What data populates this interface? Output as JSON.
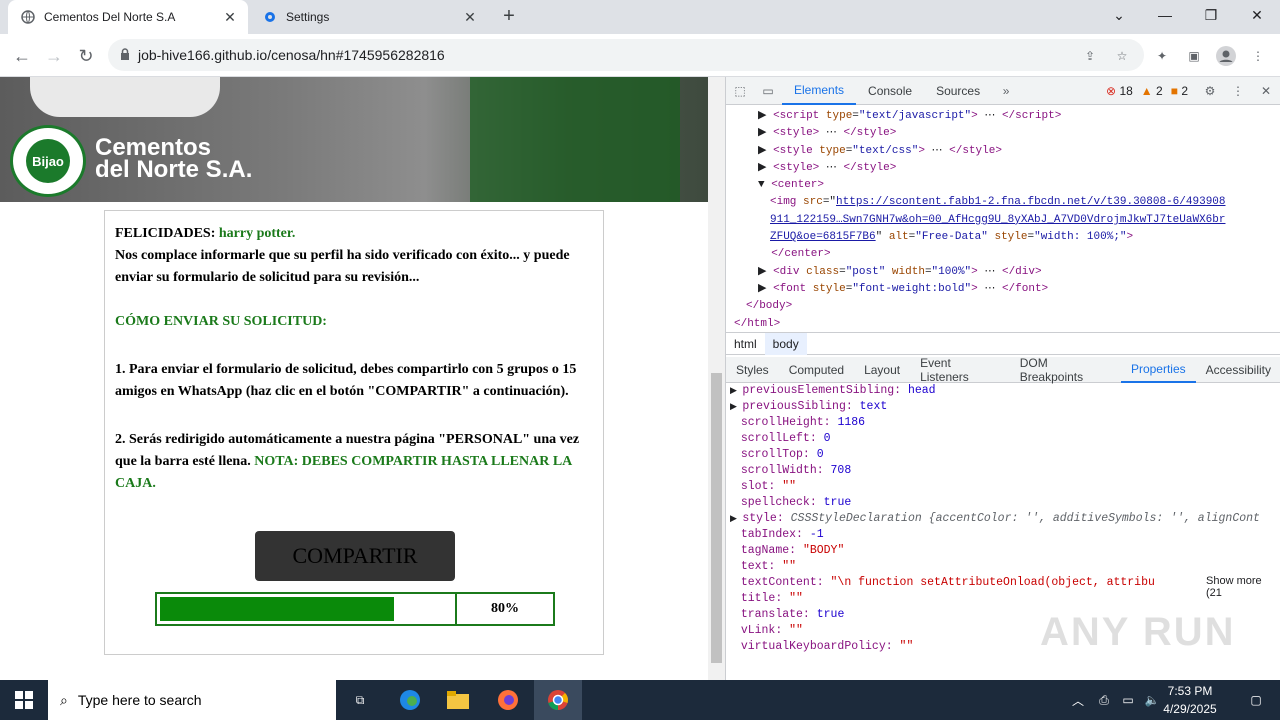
{
  "tabs": [
    {
      "label": "Cementos Del Norte S.A",
      "active": true
    },
    {
      "label": "Settings",
      "active": false
    }
  ],
  "toolbar": {
    "url": "job-hive166.github.io/cenosa/hn#1745956282816"
  },
  "banner": {
    "brand_line1": "Cementos",
    "brand_line2": "del Norte S.A.",
    "seal_top": "CEMENTO",
    "seal_mid": "Bijao",
    "seal_bottom": "CALIDAD"
  },
  "card": {
    "congrats_prefix": "FELICIDADES:",
    "name": "harry potter.",
    "intro": "Nos complace informarle que su perfil ha sido verificado con éxito... y puede enviar su formulario de solicitud para su revisión...",
    "how_title": "CÓMO ENVIAR SU SOLICITUD:",
    "step1": "1. Para enviar el formulario de solicitud, debes compartirlo con 5 grupos o 15 amigos en WhatsApp (haz clic en el botón \"COMPARTIR\" a continuación).",
    "step2_a": "2. Serás redirigido automáticamente a nuestra página \"PERSONAL\" una vez que la barra esté llena.",
    "step2_note": "NOTA: DEBES COMPARTIR HASTA LLENAR LA CAJA.",
    "share_label": "COMPARTIR",
    "progress_label": "80%",
    "progress_value": 0.8
  },
  "devtools": {
    "tabs": [
      "Elements",
      "Console",
      "Sources"
    ],
    "errors": "18",
    "warnings": "2",
    "issues": "2",
    "dom_lines": [
      {
        "indent": 0,
        "html": "▶ <span class='tg'>&lt;script</span> <span class='at'>type</span>=<span class='av'>\"text/javascript\"</span><span class='tg'>&gt;</span> ⋯ <span class='tg'>&lt;/script&gt;</span>"
      },
      {
        "indent": 0,
        "html": "▶ <span class='tg'>&lt;style&gt;</span> ⋯ <span class='tg'>&lt;/style&gt;</span>"
      },
      {
        "indent": 0,
        "html": "▶ <span class='tg'>&lt;style</span> <span class='at'>type</span>=<span class='av'>\"text/css\"</span><span class='tg'>&gt;</span> ⋯ <span class='tg'>&lt;/style&gt;</span>"
      },
      {
        "indent": 0,
        "html": "▶ <span class='tg'>&lt;style&gt;</span> ⋯ <span class='tg'>&lt;/style&gt;</span>"
      },
      {
        "indent": 0,
        "html": "▼ <span class='tg'>&lt;center&gt;</span>"
      },
      {
        "indent": 1,
        "html": "<span class='tg'>&lt;img</span> <span class='at'>src</span>=\"<span class='lk'>https://scontent.fabb1-2.fna.fbcdn.net/v/t39.30808-6/493908</span>"
      },
      {
        "indent": 1,
        "html": "<span class='lk'>911_122159…Swn7GNH7w&amp;oh=00_AfHcgg9U_8yXAbJ_A7VD0VdrojmJkwTJ7teUaWX6br</span>"
      },
      {
        "indent": 1,
        "html": "<span class='lk'>ZFUQ&amp;oe=6815F7B6</span>\" <span class='at'>alt</span>=<span class='av'>\"Free-Data\"</span> <span class='at'>style</span>=<span class='av'>\"width: 100%;\"</span><span class='tg'>&gt;</span>"
      },
      {
        "indent": 0,
        "html": "&nbsp;&nbsp;<span class='tg'>&lt;/center&gt;</span>"
      },
      {
        "indent": 0,
        "html": "▶ <span class='tg'>&lt;div</span> <span class='at'>class</span>=<span class='av'>\"post\"</span> <span class='at'>width</span>=<span class='av'>\"100%\"</span><span class='tg'>&gt;</span> ⋯ <span class='tg'>&lt;/div&gt;</span>"
      },
      {
        "indent": 0,
        "html": "▶ <span class='tg'>&lt;font</span> <span class='at'>style</span>=<span class='av'>\"font-weight:bold\"</span><span class='tg'>&gt;</span> ⋯ <span class='tg'>&lt;/font&gt;</span>"
      },
      {
        "indent": -1,
        "html": "<span class='tg'>&lt;/body&gt;</span>"
      },
      {
        "indent": -2,
        "html": "<span class='tg'>&lt;/html&gt;</span>"
      }
    ],
    "crumbs": [
      "html",
      "body"
    ],
    "subtabs": [
      "Styles",
      "Computed",
      "Layout",
      "Event Listeners",
      "DOM Breakpoints",
      "Properties",
      "Accessibility"
    ],
    "props": [
      {
        "arrow": true,
        "key": "previousElementSibling",
        "val": "head",
        "cls": "pn"
      },
      {
        "arrow": true,
        "key": "previousSibling",
        "val": "text",
        "cls": "pn"
      },
      {
        "arrow": false,
        "key": "scrollHeight",
        "val": "1186",
        "cls": "pn"
      },
      {
        "arrow": false,
        "key": "scrollLeft",
        "val": "0",
        "cls": "pn"
      },
      {
        "arrow": false,
        "key": "scrollTop",
        "val": "0",
        "cls": "pn"
      },
      {
        "arrow": false,
        "key": "scrollWidth",
        "val": "708",
        "cls": "pn"
      },
      {
        "arrow": false,
        "key": "slot",
        "val": "\"\"",
        "cls": "ps"
      },
      {
        "arrow": false,
        "key": "spellcheck",
        "val": "true",
        "cls": "pn"
      },
      {
        "arrow": true,
        "key": "style",
        "val": "CSSStyleDeclaration {accentColor: '', additiveSymbols: '', alignCont",
        "cls": "pg"
      },
      {
        "arrow": false,
        "key": "tabIndex",
        "val": "-1",
        "cls": "pn"
      },
      {
        "arrow": false,
        "key": "tagName",
        "val": "\"BODY\"",
        "cls": "ps"
      },
      {
        "arrow": false,
        "key": "text",
        "val": "\"\"",
        "cls": "ps"
      },
      {
        "arrow": false,
        "key": "textContent",
        "val": "\"\\n    function setAttributeOnload(object, attribu",
        "cls": "ps"
      },
      {
        "arrow": false,
        "key": "title",
        "val": "\"\"",
        "cls": "ps"
      },
      {
        "arrow": false,
        "key": "translate",
        "val": "true",
        "cls": "pn"
      },
      {
        "arrow": false,
        "key": "vLink",
        "val": "\"\"",
        "cls": "ps"
      },
      {
        "arrow": false,
        "key": "virtualKeyboardPolicy",
        "val": "\"\"",
        "cls": "ps"
      }
    ],
    "show_more": "Show more (21"
  },
  "taskbar": {
    "search_placeholder": "Type here to search",
    "time": "7:53 PM",
    "date": "4/29/2025"
  },
  "watermark": "ANY RUN"
}
